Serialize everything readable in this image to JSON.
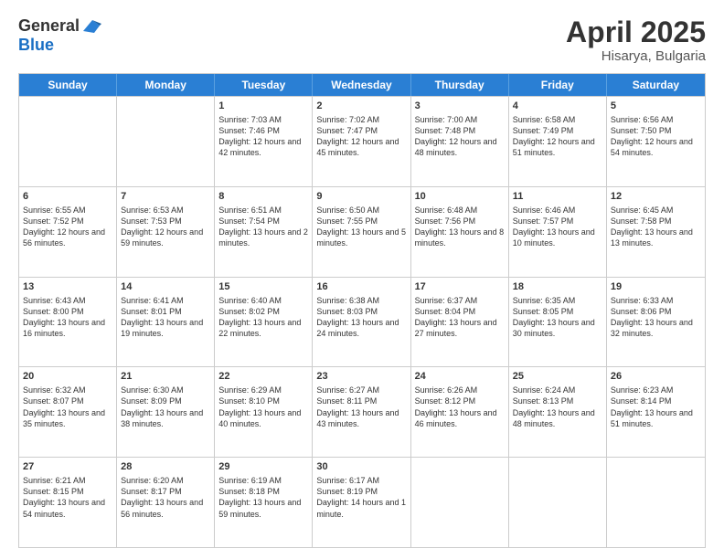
{
  "logo": {
    "general": "General",
    "blue": "Blue"
  },
  "title": "April 2025",
  "location": "Hisarya, Bulgaria",
  "days": [
    "Sunday",
    "Monday",
    "Tuesday",
    "Wednesday",
    "Thursday",
    "Friday",
    "Saturday"
  ],
  "weeks": [
    [
      {
        "day": "",
        "sunrise": "",
        "sunset": "",
        "daylight": ""
      },
      {
        "day": "",
        "sunrise": "",
        "sunset": "",
        "daylight": ""
      },
      {
        "day": "1",
        "sunrise": "Sunrise: 7:03 AM",
        "sunset": "Sunset: 7:46 PM",
        "daylight": "Daylight: 12 hours and 42 minutes."
      },
      {
        "day": "2",
        "sunrise": "Sunrise: 7:02 AM",
        "sunset": "Sunset: 7:47 PM",
        "daylight": "Daylight: 12 hours and 45 minutes."
      },
      {
        "day": "3",
        "sunrise": "Sunrise: 7:00 AM",
        "sunset": "Sunset: 7:48 PM",
        "daylight": "Daylight: 12 hours and 48 minutes."
      },
      {
        "day": "4",
        "sunrise": "Sunrise: 6:58 AM",
        "sunset": "Sunset: 7:49 PM",
        "daylight": "Daylight: 12 hours and 51 minutes."
      },
      {
        "day": "5",
        "sunrise": "Sunrise: 6:56 AM",
        "sunset": "Sunset: 7:50 PM",
        "daylight": "Daylight: 12 hours and 54 minutes."
      }
    ],
    [
      {
        "day": "6",
        "sunrise": "Sunrise: 6:55 AM",
        "sunset": "Sunset: 7:52 PM",
        "daylight": "Daylight: 12 hours and 56 minutes."
      },
      {
        "day": "7",
        "sunrise": "Sunrise: 6:53 AM",
        "sunset": "Sunset: 7:53 PM",
        "daylight": "Daylight: 12 hours and 59 minutes."
      },
      {
        "day": "8",
        "sunrise": "Sunrise: 6:51 AM",
        "sunset": "Sunset: 7:54 PM",
        "daylight": "Daylight: 13 hours and 2 minutes."
      },
      {
        "day": "9",
        "sunrise": "Sunrise: 6:50 AM",
        "sunset": "Sunset: 7:55 PM",
        "daylight": "Daylight: 13 hours and 5 minutes."
      },
      {
        "day": "10",
        "sunrise": "Sunrise: 6:48 AM",
        "sunset": "Sunset: 7:56 PM",
        "daylight": "Daylight: 13 hours and 8 minutes."
      },
      {
        "day": "11",
        "sunrise": "Sunrise: 6:46 AM",
        "sunset": "Sunset: 7:57 PM",
        "daylight": "Daylight: 13 hours and 10 minutes."
      },
      {
        "day": "12",
        "sunrise": "Sunrise: 6:45 AM",
        "sunset": "Sunset: 7:58 PM",
        "daylight": "Daylight: 13 hours and 13 minutes."
      }
    ],
    [
      {
        "day": "13",
        "sunrise": "Sunrise: 6:43 AM",
        "sunset": "Sunset: 8:00 PM",
        "daylight": "Daylight: 13 hours and 16 minutes."
      },
      {
        "day": "14",
        "sunrise": "Sunrise: 6:41 AM",
        "sunset": "Sunset: 8:01 PM",
        "daylight": "Daylight: 13 hours and 19 minutes."
      },
      {
        "day": "15",
        "sunrise": "Sunrise: 6:40 AM",
        "sunset": "Sunset: 8:02 PM",
        "daylight": "Daylight: 13 hours and 22 minutes."
      },
      {
        "day": "16",
        "sunrise": "Sunrise: 6:38 AM",
        "sunset": "Sunset: 8:03 PM",
        "daylight": "Daylight: 13 hours and 24 minutes."
      },
      {
        "day": "17",
        "sunrise": "Sunrise: 6:37 AM",
        "sunset": "Sunset: 8:04 PM",
        "daylight": "Daylight: 13 hours and 27 minutes."
      },
      {
        "day": "18",
        "sunrise": "Sunrise: 6:35 AM",
        "sunset": "Sunset: 8:05 PM",
        "daylight": "Daylight: 13 hours and 30 minutes."
      },
      {
        "day": "19",
        "sunrise": "Sunrise: 6:33 AM",
        "sunset": "Sunset: 8:06 PM",
        "daylight": "Daylight: 13 hours and 32 minutes."
      }
    ],
    [
      {
        "day": "20",
        "sunrise": "Sunrise: 6:32 AM",
        "sunset": "Sunset: 8:07 PM",
        "daylight": "Daylight: 13 hours and 35 minutes."
      },
      {
        "day": "21",
        "sunrise": "Sunrise: 6:30 AM",
        "sunset": "Sunset: 8:09 PM",
        "daylight": "Daylight: 13 hours and 38 minutes."
      },
      {
        "day": "22",
        "sunrise": "Sunrise: 6:29 AM",
        "sunset": "Sunset: 8:10 PM",
        "daylight": "Daylight: 13 hours and 40 minutes."
      },
      {
        "day": "23",
        "sunrise": "Sunrise: 6:27 AM",
        "sunset": "Sunset: 8:11 PM",
        "daylight": "Daylight: 13 hours and 43 minutes."
      },
      {
        "day": "24",
        "sunrise": "Sunrise: 6:26 AM",
        "sunset": "Sunset: 8:12 PM",
        "daylight": "Daylight: 13 hours and 46 minutes."
      },
      {
        "day": "25",
        "sunrise": "Sunrise: 6:24 AM",
        "sunset": "Sunset: 8:13 PM",
        "daylight": "Daylight: 13 hours and 48 minutes."
      },
      {
        "day": "26",
        "sunrise": "Sunrise: 6:23 AM",
        "sunset": "Sunset: 8:14 PM",
        "daylight": "Daylight: 13 hours and 51 minutes."
      }
    ],
    [
      {
        "day": "27",
        "sunrise": "Sunrise: 6:21 AM",
        "sunset": "Sunset: 8:15 PM",
        "daylight": "Daylight: 13 hours and 54 minutes."
      },
      {
        "day": "28",
        "sunrise": "Sunrise: 6:20 AM",
        "sunset": "Sunset: 8:17 PM",
        "daylight": "Daylight: 13 hours and 56 minutes."
      },
      {
        "day": "29",
        "sunrise": "Sunrise: 6:19 AM",
        "sunset": "Sunset: 8:18 PM",
        "daylight": "Daylight: 13 hours and 59 minutes."
      },
      {
        "day": "30",
        "sunrise": "Sunrise: 6:17 AM",
        "sunset": "Sunset: 8:19 PM",
        "daylight": "Daylight: 14 hours and 1 minute."
      },
      {
        "day": "",
        "sunrise": "",
        "sunset": "",
        "daylight": ""
      },
      {
        "day": "",
        "sunrise": "",
        "sunset": "",
        "daylight": ""
      },
      {
        "day": "",
        "sunrise": "",
        "sunset": "",
        "daylight": ""
      }
    ]
  ]
}
